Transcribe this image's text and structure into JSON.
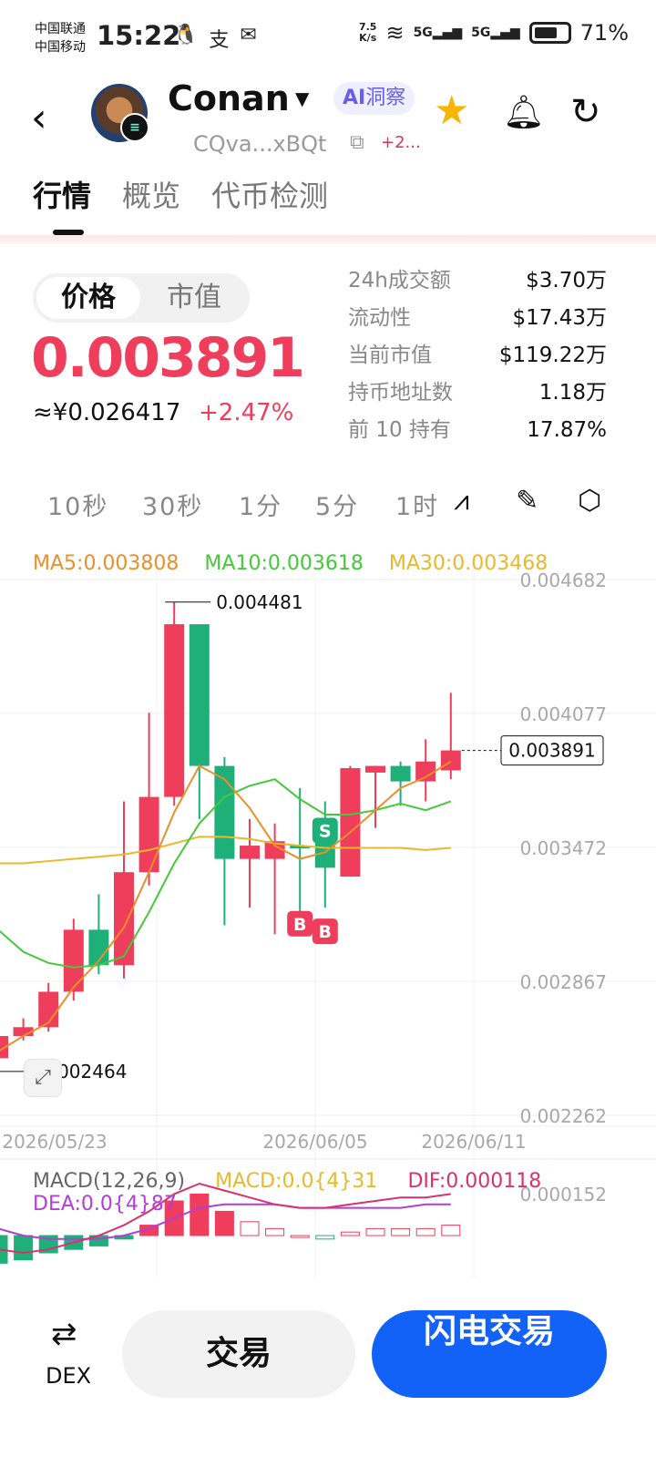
{
  "status_bar": {
    "carrier_1": "中国联通",
    "carrier_2": "中国移动",
    "time": "15:22",
    "net_speed_value": "7.5",
    "net_speed_unit": "K/s",
    "signal_1": "5G",
    "signal_2": "5G",
    "battery": "71%",
    "battery_level": 0.71
  },
  "header": {
    "token_name": "Conan",
    "ai_tag": "洞察",
    "ai_prefix": "AI",
    "address": "CQva...xBQt",
    "more_chains": "+2..."
  },
  "tabs": [
    "行情",
    "概览",
    "代币检测"
  ],
  "price": {
    "toggle_price": "价格",
    "toggle_mcap": "市值",
    "value": "0.003891",
    "cny": "≈¥0.026417",
    "change": "+2.47%"
  },
  "stats": [
    {
      "label": "24h成交额",
      "value": "$3.70万"
    },
    {
      "label": "流动性",
      "value": "$17.43万"
    },
    {
      "label": "当前市值",
      "value": "$119.22万"
    },
    {
      "label": "持币地址数",
      "value": "1.18万"
    },
    {
      "label": "前 10 持有",
      "value": "17.87%"
    }
  ],
  "intervals": [
    "10秒",
    "30秒",
    "1分",
    "5分",
    "1时"
  ],
  "ma_legend": {
    "ma5": "MA5:0.003808",
    "ma10": "MA10:0.003618",
    "ma30": "MA30:0.003468"
  },
  "macd_legend": {
    "title": "MACD(12,26,9)",
    "macd": "MACD:0.0{4}31",
    "dif": "DIF:0.000118",
    "dea": "DEA:0.0{4}87"
  },
  "colors": {
    "up": "#ef3d5c",
    "down": "#1fb07a",
    "ma5": "#e8902a",
    "ma10": "#44c93b",
    "ma30": "#e8b92a",
    "accent": "#1262f7"
  },
  "bottom": {
    "dex": "DEX",
    "trade": "交易",
    "flash_trade": "闪电交易"
  },
  "chart_data": {
    "type": "candlestick",
    "y_ticks": [
      "0.004682",
      "0.004077",
      "0.003472",
      "0.002867",
      "0.002262"
    ],
    "ylim": [
      0.002262,
      0.004682
    ],
    "x_ticks": [
      "2026/05/23",
      "2026/06/05",
      "2026/06/11"
    ],
    "high_label": "0.004481",
    "low_label": "0.002464",
    "current_label": "0.003891",
    "markers": [
      "S",
      "B",
      "B"
    ],
    "candles": [
      {
        "open": 0.00252,
        "close": 0.00262,
        "high": 0.00262,
        "low": 0.00246
      },
      {
        "open": 0.00262,
        "close": 0.00266,
        "high": 0.0027,
        "low": 0.0026
      },
      {
        "open": 0.00266,
        "close": 0.00282,
        "high": 0.00286,
        "low": 0.00264
      },
      {
        "open": 0.00282,
        "close": 0.0031,
        "high": 0.00315,
        "low": 0.00278
      },
      {
        "open": 0.0031,
        "close": 0.00294,
        "high": 0.00326,
        "low": 0.0029
      },
      {
        "open": 0.00294,
        "close": 0.00336,
        "high": 0.00368,
        "low": 0.00288
      },
      {
        "open": 0.00336,
        "close": 0.0037,
        "high": 0.00408,
        "low": 0.0033
      },
      {
        "open": 0.0037,
        "close": 0.00448,
        "high": 0.00458,
        "low": 0.00366
      },
      {
        "open": 0.00448,
        "close": 0.00384,
        "high": 0.00448,
        "low": 0.0036
      },
      {
        "open": 0.00384,
        "close": 0.00342,
        "high": 0.00388,
        "low": 0.00312
      },
      {
        "open": 0.00342,
        "close": 0.00348,
        "high": 0.0036,
        "low": 0.0032
      },
      {
        "open": 0.00342,
        "close": 0.0035,
        "high": 0.00358,
        "low": 0.00308
      },
      {
        "open": 0.00348,
        "close": 0.00347,
        "high": 0.00374,
        "low": 0.00316
      },
      {
        "open": 0.0035,
        "close": 0.00338,
        "high": 0.00368,
        "low": 0.0032
      },
      {
        "open": 0.00334,
        "close": 0.00383,
        "high": 0.00384,
        "low": 0.00334
      },
      {
        "open": 0.00381,
        "close": 0.00384,
        "high": 0.00384,
        "low": 0.00356
      },
      {
        "open": 0.00384,
        "close": 0.00377,
        "high": 0.00386,
        "low": 0.00366
      },
      {
        "open": 0.00377,
        "close": 0.00386,
        "high": 0.00396,
        "low": 0.00368
      },
      {
        "open": 0.00382,
        "close": 0.00391,
        "high": 0.00417,
        "low": 0.00378
      }
    ],
    "ma5": [
      0.00255,
      0.00262,
      0.00268,
      0.00284,
      0.00296,
      0.00311,
      0.00336,
      0.00363,
      0.00384,
      0.00378,
      0.00365,
      0.00348,
      0.00342,
      0.00345,
      0.00354,
      0.00364,
      0.00374,
      0.00379,
      0.00386
    ],
    "ma10": [
      0.0031,
      0.003,
      0.00295,
      0.00293,
      0.00294,
      0.00298,
      0.00318,
      0.0034,
      0.00358,
      0.0037,
      0.00375,
      0.00378,
      0.00369,
      0.00362,
      0.00362,
      0.00364,
      0.00367,
      0.00364,
      0.00368
    ],
    "ma30": [
      0.0034,
      0.0034,
      0.00341,
      0.00342,
      0.00343,
      0.00344,
      0.00346,
      0.00349,
      0.00352,
      0.00352,
      0.00351,
      0.00349,
      0.00348,
      0.00347,
      0.00347,
      0.00347,
      0.00347,
      0.00346,
      0.00347
    ],
    "macd_hist": [
      -8e-05,
      -7e-05,
      -5e-05,
      -4e-05,
      -3e-05,
      -1e-05,
      3e-05,
      0.0001,
      0.00012,
      7e-05,
      4e-05,
      2e-05,
      0.0,
      -1e-05,
      1e-05,
      2e-05,
      2e-05,
      2e-05,
      3e-05
    ],
    "dif": [
      -4e-05,
      -5e-05,
      -4e-05,
      -2e-05,
      0.0,
      3e-05,
      7e-05,
      0.00012,
      0.00015,
      0.00013,
      0.00011,
      9e-05,
      8e-05,
      8e-05,
      9e-05,
      0.0001,
      0.00011,
      0.00011,
      0.00012
    ],
    "dea": [
      2e-05,
      0.0,
      -1e-05,
      -1e-05,
      -1e-05,
      0.0,
      2e-05,
      5e-05,
      8e-05,
      9e-05,
      9e-05,
      9e-05,
      8e-05,
      8e-05,
      8e-05,
      8e-05,
      8e-05,
      9e-05,
      9e-05
    ]
  }
}
